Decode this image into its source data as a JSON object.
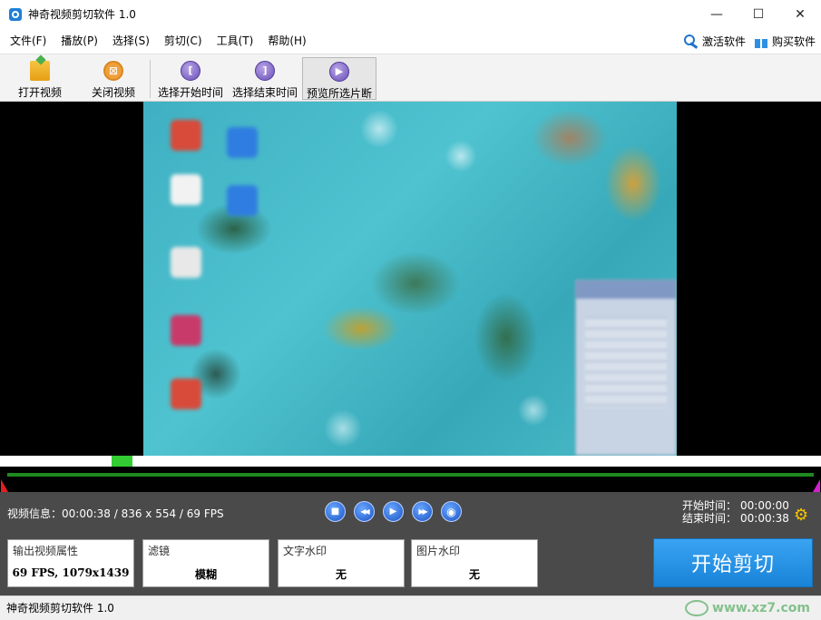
{
  "window": {
    "title": "神奇视频剪切软件 1.0",
    "controls": {
      "minimize": "—",
      "maximize": "☐",
      "close": "✕"
    }
  },
  "menu": {
    "items": [
      "文件(F)",
      "播放(P)",
      "选择(S)",
      "剪切(C)",
      "工具(T)",
      "帮助(H)"
    ],
    "activate": "激活软件",
    "buy": "购买软件"
  },
  "toolbar": {
    "open_video": "打开视频",
    "close_video": "关闭视频",
    "select_start": "选择开始时间",
    "select_end": "选择结束时间",
    "preview": "预览所选片断",
    "start_glyph": "[",
    "end_glyph": "]",
    "preview_glyph": "▶"
  },
  "player": {
    "progress": 0.14
  },
  "info": {
    "video_info": "视频信息：00:00:38 / 836 x 554 / 69 FPS",
    "start_label": "开始时间：",
    "start_time": "00:00:00",
    "end_label": "结束时间：",
    "end_time": "00:00:38"
  },
  "playback": {
    "stop": "■",
    "rewind": "◀◀",
    "play": "▶",
    "forward": "▶▶",
    "snapshot": "◉"
  },
  "options": {
    "output": {
      "label": "输出视频属性",
      "value": "69 FPS, 1079x1439"
    },
    "filter": {
      "label": "滤镜",
      "value": "模糊"
    },
    "text_watermark": {
      "label": "文字水印",
      "value": "无"
    },
    "image_watermark": {
      "label": "图片水印",
      "value": "无"
    }
  },
  "start_cut": "开始剪切",
  "status": {
    "text": "神奇视频剪切软件 1.0",
    "watermark_text": "www.xz7.com"
  },
  "colors": {
    "accent_blue": "#1f7fd6",
    "panel_bg": "#4a4a4a",
    "timeline_green": "#1e8a1e",
    "scrub_green": "#33cc33",
    "start_marker": "#e02020",
    "end_marker": "#d020d0"
  }
}
